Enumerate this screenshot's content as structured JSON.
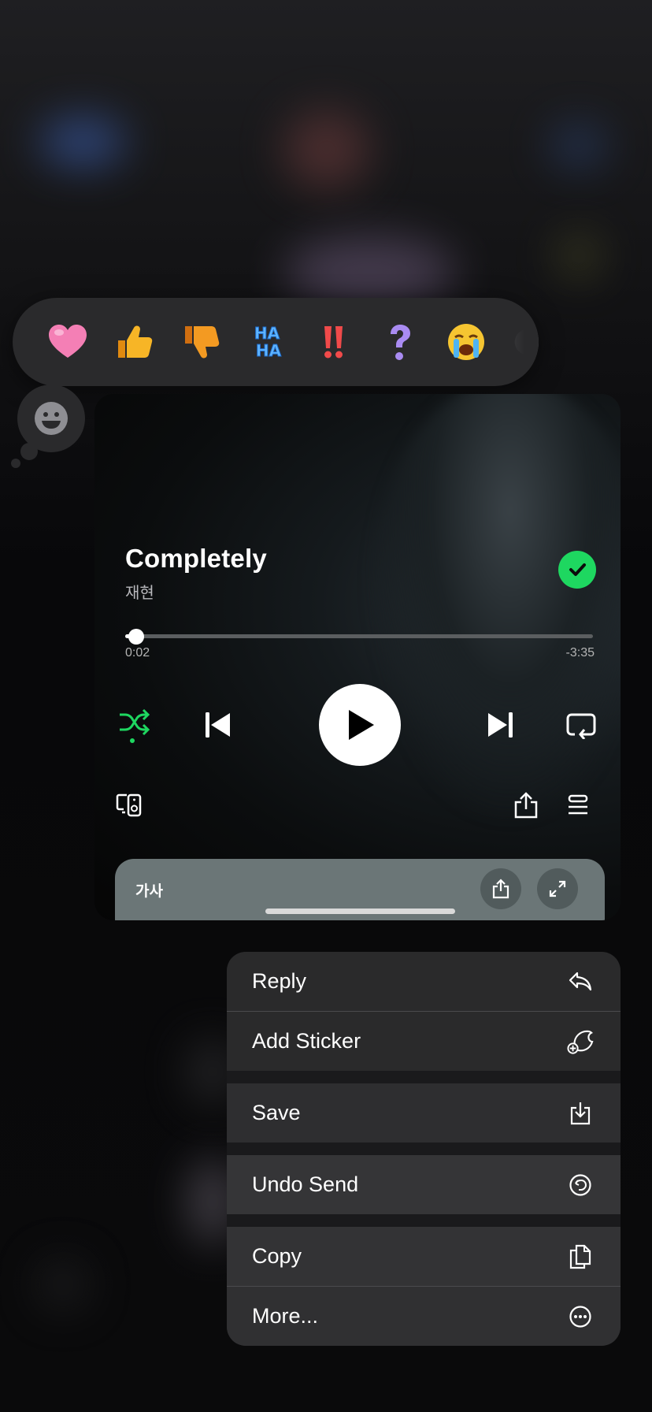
{
  "reactions": [
    {
      "name": "heart-reaction-icon"
    },
    {
      "name": "thumbs-up-reaction-icon"
    },
    {
      "name": "thumbs-down-reaction-icon"
    },
    {
      "name": "haha-reaction-icon",
      "text_top": "HA",
      "text_bottom": "HA"
    },
    {
      "name": "exclamation-reaction-icon"
    },
    {
      "name": "question-reaction-icon"
    },
    {
      "name": "crying-face-reaction-icon"
    }
  ],
  "player": {
    "song_title": "Completely",
    "artist": "재현",
    "elapsed": "0:02",
    "remaining": "-3:35",
    "progress": 0.02,
    "liked": true
  },
  "lyrics": {
    "label": "가사"
  },
  "menu": {
    "items": [
      {
        "label": "Reply",
        "icon": "reply-icon"
      },
      {
        "label": "Add Sticker",
        "icon": "add-sticker-icon"
      },
      {
        "label": "Save",
        "icon": "save-icon"
      },
      {
        "label": "Undo Send",
        "icon": "undo-send-icon"
      },
      {
        "label": "Copy",
        "icon": "copy-icon"
      },
      {
        "label": "More...",
        "icon": "more-icon"
      }
    ]
  },
  "colors": {
    "accent_green": "#1ed760",
    "menu_bg": "#2a2a2b",
    "reaction_bar_bg": "#2a2a2c"
  }
}
